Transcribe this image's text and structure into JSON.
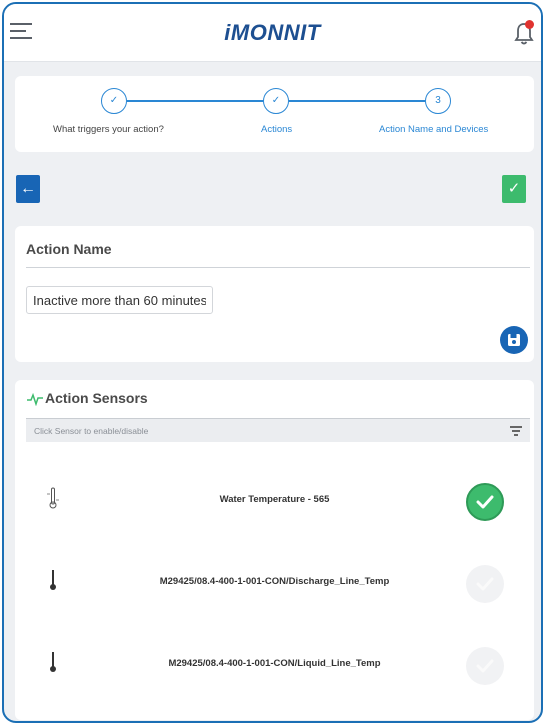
{
  "header": {
    "logo_text": "MONNIT",
    "logo_prefix": "i",
    "notification_indicator": true
  },
  "stepper": {
    "steps": [
      {
        "label": "What triggers your action?",
        "marker": "✓",
        "state": "complete"
      },
      {
        "label": "Actions",
        "marker": "✓",
        "state": "complete"
      },
      {
        "label": "Action Name and Devices",
        "marker": "3",
        "state": "current"
      }
    ]
  },
  "nav": {
    "back_symbol": "←",
    "done_symbol": "✓"
  },
  "action_name": {
    "title": "Action Name",
    "value": "Inactive more than 60 minutes"
  },
  "sensors": {
    "title": "Action Sensors",
    "hint": "Click Sensor to enable/disable",
    "items": [
      {
        "name": "Water Temperature - 565",
        "enabled": true,
        "check": "✓"
      },
      {
        "name": "M29425/08.4-400-1-001-CON/Discharge_Line_Temp",
        "enabled": false,
        "check": "✓"
      },
      {
        "name": "M29425/08.4-400-1-001-CON/Liquid_Line_Temp",
        "enabled": false,
        "check": "✓"
      }
    ]
  },
  "colors": {
    "primary": "#1865b5",
    "accent": "#2a87d4",
    "success": "#3dbb6d",
    "logo": "#1d4f91",
    "alert": "#e0332f"
  }
}
